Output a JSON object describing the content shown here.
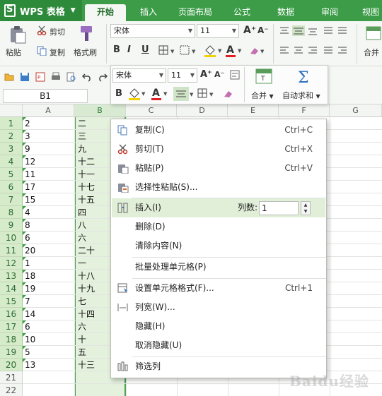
{
  "app": {
    "name": "WPS 表格"
  },
  "tabs": [
    "开始",
    "插入",
    "页面布局",
    "公式",
    "数据",
    "审阅",
    "视图"
  ],
  "ribbon": {
    "paste": "粘贴",
    "cut": "剪切",
    "copy": "复制",
    "format_painter": "格式刷",
    "font_name": "宋体",
    "font_size": "11",
    "merge": "合并"
  },
  "name_box": "B1",
  "mini_toolbar": {
    "font_name": "宋体",
    "font_size": "11",
    "merge": "合并",
    "autosum": "自动求和"
  },
  "columns": [
    "A",
    "B",
    "C",
    "D",
    "E",
    "F",
    "G"
  ],
  "rows": [
    {
      "n": "1",
      "a": "2",
      "b": "二"
    },
    {
      "n": "2",
      "a": "3",
      "b": "三"
    },
    {
      "n": "3",
      "a": "9",
      "b": "九"
    },
    {
      "n": "4",
      "a": "12",
      "b": "十二"
    },
    {
      "n": "5",
      "a": "11",
      "b": "十一"
    },
    {
      "n": "6",
      "a": "17",
      "b": "十七"
    },
    {
      "n": "7",
      "a": "15",
      "b": "十五"
    },
    {
      "n": "8",
      "a": "4",
      "b": "四"
    },
    {
      "n": "9",
      "a": "8",
      "b": "八"
    },
    {
      "n": "10",
      "a": "6",
      "b": "六"
    },
    {
      "n": "11",
      "a": "20",
      "b": "二十"
    },
    {
      "n": "12",
      "a": "1",
      "b": "一"
    },
    {
      "n": "13",
      "a": "18",
      "b": "十八"
    },
    {
      "n": "14",
      "a": "19",
      "b": "十九"
    },
    {
      "n": "15",
      "a": "7",
      "b": "七"
    },
    {
      "n": "16",
      "a": "14",
      "b": "十四"
    },
    {
      "n": "17",
      "a": "6",
      "b": "六"
    },
    {
      "n": "18",
      "a": "10",
      "b": "十"
    },
    {
      "n": "19",
      "a": "5",
      "b": "五"
    },
    {
      "n": "20",
      "a": "13",
      "b": "十三"
    },
    {
      "n": "21",
      "a": "",
      "b": ""
    },
    {
      "n": "22",
      "a": "",
      "b": ""
    }
  ],
  "context_menu": {
    "copy": {
      "label": "复制(C)",
      "shortcut": "Ctrl+C"
    },
    "cut": {
      "label": "剪切(T)",
      "shortcut": "Ctrl+X"
    },
    "paste": {
      "label": "粘贴(P)",
      "shortcut": "Ctrl+V"
    },
    "paste_special": {
      "label": "选择性粘贴(S)..."
    },
    "insert": {
      "label": "插入(I)",
      "count_label": "列数:",
      "count_value": "1"
    },
    "delete": {
      "label": "删除(D)"
    },
    "clear": {
      "label": "清除内容(N)"
    },
    "batch": {
      "label": "批量处理单元格(P)"
    },
    "format_cells": {
      "label": "设置单元格格式(F)...",
      "shortcut": "Ctrl+1"
    },
    "col_width": {
      "label": "列宽(W)..."
    },
    "hide": {
      "label": "隐藏(H)"
    },
    "unhide": {
      "label": "取消隐藏(U)"
    },
    "filter": {
      "label": "筛选列"
    }
  },
  "watermark": "Baidu经验",
  "colors": {
    "brand": "#3c9c48",
    "selection": "#e4f1dd",
    "highlight": "#e1efd9"
  }
}
